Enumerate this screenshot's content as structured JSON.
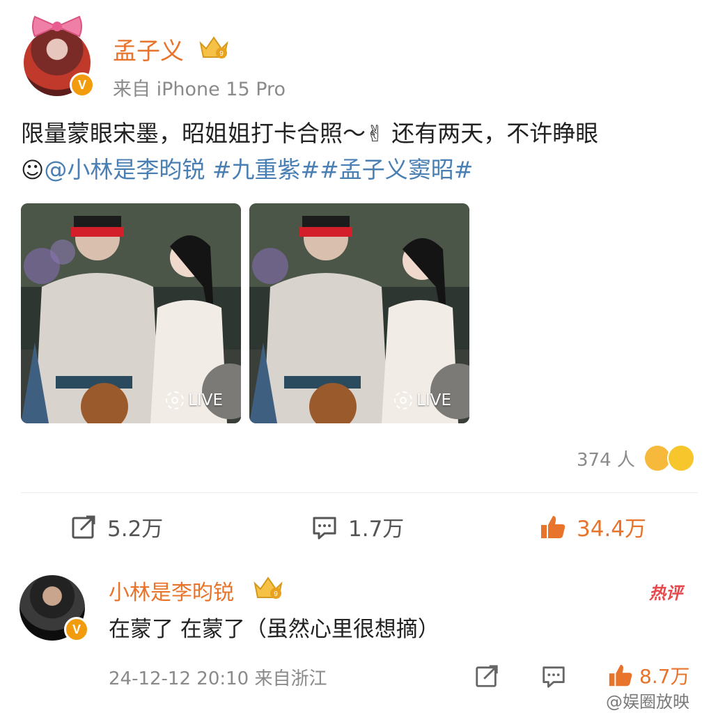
{
  "post": {
    "username": "孟子义",
    "source": "来自 iPhone 15 Pro",
    "text_line1": "限量蒙眼宋墨，昭姐姐打卡合照～",
    "emoji_victory": "✌",
    "text_line1_cont": " 还有两天，不许睁眼",
    "emoji_smile": "☺",
    "mention": "@小林是李昀锐",
    "hashtags": " #九重紫##孟子义窦昭#",
    "images": [
      {
        "live_label": "LIVE"
      },
      {
        "live_label": "LIVE"
      }
    ],
    "reaction_count": "374 人"
  },
  "actions": {
    "repost": "5.2万",
    "comment": "1.7万",
    "like": "34.4万"
  },
  "comment": {
    "username": "小林是李昀锐",
    "badge": "热评",
    "text": "在蒙了 在蒙了（虽然心里很想摘）",
    "meta": "24-12-12 20:10 来自浙江",
    "likes": "8.7万"
  },
  "watermark": "@娱圈放映",
  "colors": {
    "accent_orange": "#e8742b",
    "link_blue": "#4a7fb3",
    "meta_gray": "#8a8a8a"
  },
  "icons": [
    "crown-level-icon",
    "verified-v-icon",
    "live-photo-icon",
    "share-icon",
    "comment-icon",
    "like-thumb-icon"
  ]
}
